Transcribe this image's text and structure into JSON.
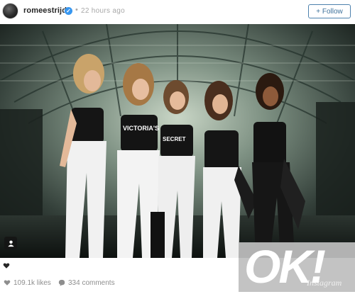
{
  "header": {
    "username": "romeestrijd",
    "verified_icon": "check-icon",
    "separator": "•",
    "timestamp": "22 hours ago",
    "follow_label": "+ Follow"
  },
  "photo": {
    "shirt_text_1": "VICTORIA'S",
    "shirt_text_2": "SECRET"
  },
  "footer": {
    "likes": "109.1k likes",
    "comments": "334 comments"
  },
  "overlay": {
    "brand_logo": "OK!",
    "watermark": "Instagram"
  },
  "colors": {
    "follow_text": "#3f729b",
    "verified_badge": "#3897f0",
    "meta_text": "#a8a8a8"
  }
}
